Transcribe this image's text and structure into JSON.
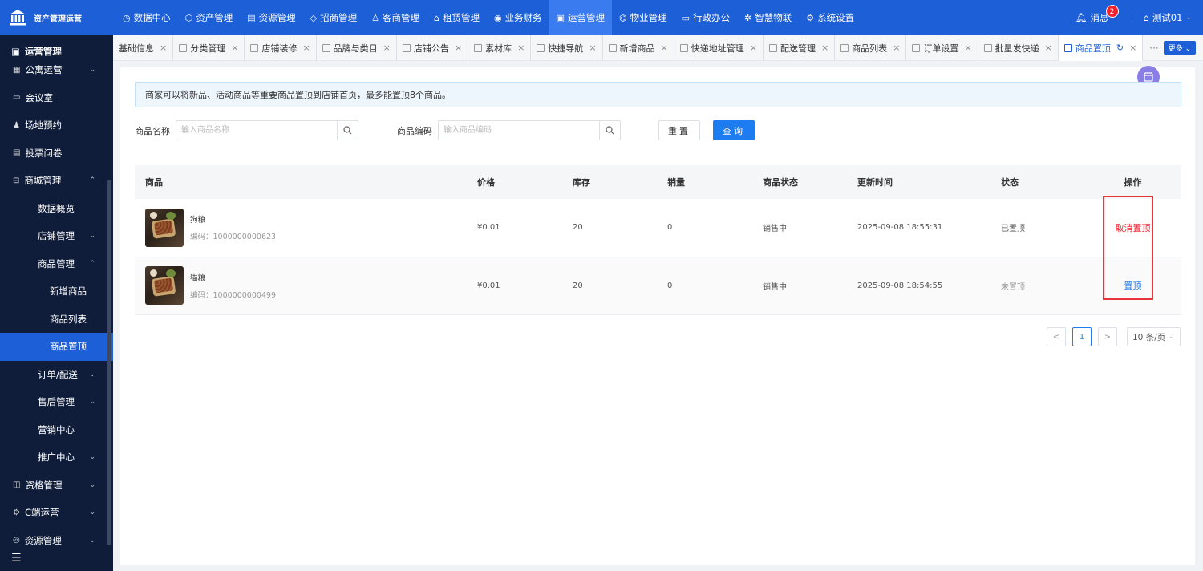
{
  "app": {
    "logo_text": "资产管理运营"
  },
  "topnav": [
    {
      "label": "数据中心",
      "icon": "◷",
      "icon_name": "clock-icon"
    },
    {
      "label": "资产管理",
      "icon": "⬡",
      "icon_name": "cube-icon"
    },
    {
      "label": "资源管理",
      "icon": "▤",
      "icon_name": "building-icon"
    },
    {
      "label": "招商管理",
      "icon": "◇",
      "icon_name": "tag-icon"
    },
    {
      "label": "客商管理",
      "icon": "♙",
      "icon_name": "users-icon"
    },
    {
      "label": "租赁管理",
      "icon": "⌂",
      "icon_name": "home-icon"
    },
    {
      "label": "业务财务",
      "icon": "◉",
      "icon_name": "coin-icon"
    },
    {
      "label": "运营管理",
      "icon": "▣",
      "icon_name": "operation-icon",
      "active": true
    },
    {
      "label": "物业管理",
      "icon": "⌬",
      "icon_name": "property-icon"
    },
    {
      "label": "行政办公",
      "icon": "▭",
      "icon_name": "monitor-icon"
    },
    {
      "label": "智慧物联",
      "icon": "✲",
      "icon_name": "iot-icon"
    },
    {
      "label": "系统设置",
      "icon": "⚙",
      "icon_name": "gear-icon"
    }
  ],
  "topright": {
    "messages_label": "消息",
    "badge": "2",
    "user": "测试01"
  },
  "sidebar": {
    "title": "运营管理",
    "items": [
      {
        "label": "公寓运营",
        "level": 0,
        "chev": "⌄",
        "icon": "▦"
      },
      {
        "label": "会议室",
        "level": 0,
        "icon": "▭"
      },
      {
        "label": "场地预约",
        "level": 0,
        "icon": "♟"
      },
      {
        "label": "投票问卷",
        "level": 0,
        "icon": "▤"
      },
      {
        "label": "商城管理",
        "level": 0,
        "chev": "⌃",
        "icon": "⊟"
      },
      {
        "label": "数据概览",
        "level": 1
      },
      {
        "label": "店铺管理",
        "level": 1,
        "chev": "⌄"
      },
      {
        "label": "商品管理",
        "level": 1,
        "chev": "⌃"
      },
      {
        "label": "新增商品",
        "level": 2
      },
      {
        "label": "商品列表",
        "level": 2
      },
      {
        "label": "商品置顶",
        "level": 2,
        "active": true
      },
      {
        "label": "订单/配送",
        "level": 1,
        "chev": "⌄"
      },
      {
        "label": "售后管理",
        "level": 1,
        "chev": "⌄"
      },
      {
        "label": "营销中心",
        "level": 1
      },
      {
        "label": "推广中心",
        "level": 1,
        "chev": "⌄"
      },
      {
        "label": "资格管理",
        "level": 0,
        "chev": "⌄",
        "icon": "◫"
      },
      {
        "label": "C端运营",
        "level": 0,
        "chev": "⌄",
        "icon": "⚙"
      },
      {
        "label": "资源管理",
        "level": 0,
        "chev": "⌄",
        "icon": "◎"
      }
    ]
  },
  "tabs": [
    {
      "label": "基础信息",
      "sq": false
    },
    {
      "label": "分类管理",
      "sq": true
    },
    {
      "label": "店铺装修",
      "sq": true
    },
    {
      "label": "品牌与类目",
      "sq": true
    },
    {
      "label": "店铺公告",
      "sq": true
    },
    {
      "label": "素材库",
      "sq": true
    },
    {
      "label": "快捷导航",
      "sq": true
    },
    {
      "label": "新增商品",
      "sq": true
    },
    {
      "label": "快递地址管理",
      "sq": true
    },
    {
      "label": "配送管理",
      "sq": true
    },
    {
      "label": "商品列表",
      "sq": true
    },
    {
      "label": "订单设置",
      "sq": true
    },
    {
      "label": "批量发快递",
      "sq": true
    },
    {
      "label": "商品置顶",
      "sq": true,
      "active": true
    }
  ],
  "more_label": "更多",
  "notice": "商家可以将新品、活动商品等重要商品置顶到店铺首页，最多能置顶8个商品。",
  "search": {
    "name_label": "商品名称",
    "name_placeholder": "输入商品名称",
    "code_label": "商品编码",
    "code_placeholder": "输入商品编码",
    "reset": "重置",
    "query": "查询"
  },
  "table": {
    "headers": [
      "商品",
      "价格",
      "库存",
      "销量",
      "商品状态",
      "更新时间",
      "状态",
      "操作"
    ],
    "rows": [
      {
        "name": "狗粮",
        "code": "编码：1000000000623",
        "price": "¥0.01",
        "stock": "20",
        "sales": "0",
        "goods_status": "销售中",
        "updated": "2025-09-08 18:55:31",
        "status": "已置顶",
        "op": "取消置顶"
      },
      {
        "name": "猫粮",
        "code": "编码：1000000000499",
        "price": "¥0.01",
        "stock": "20",
        "sales": "0",
        "goods_status": "销售中",
        "updated": "2025-09-08 18:54:55",
        "status": "未置顶",
        "op": "置顶"
      }
    ]
  },
  "pagination": {
    "current": "1",
    "size_label": "10 条/页",
    "prev": "<",
    "next": ">"
  },
  "colors": {
    "primary": "#1d5fd6",
    "sidebar": "#0f1d3a",
    "danger": "#f5222d",
    "link": "#1d7cf0"
  }
}
